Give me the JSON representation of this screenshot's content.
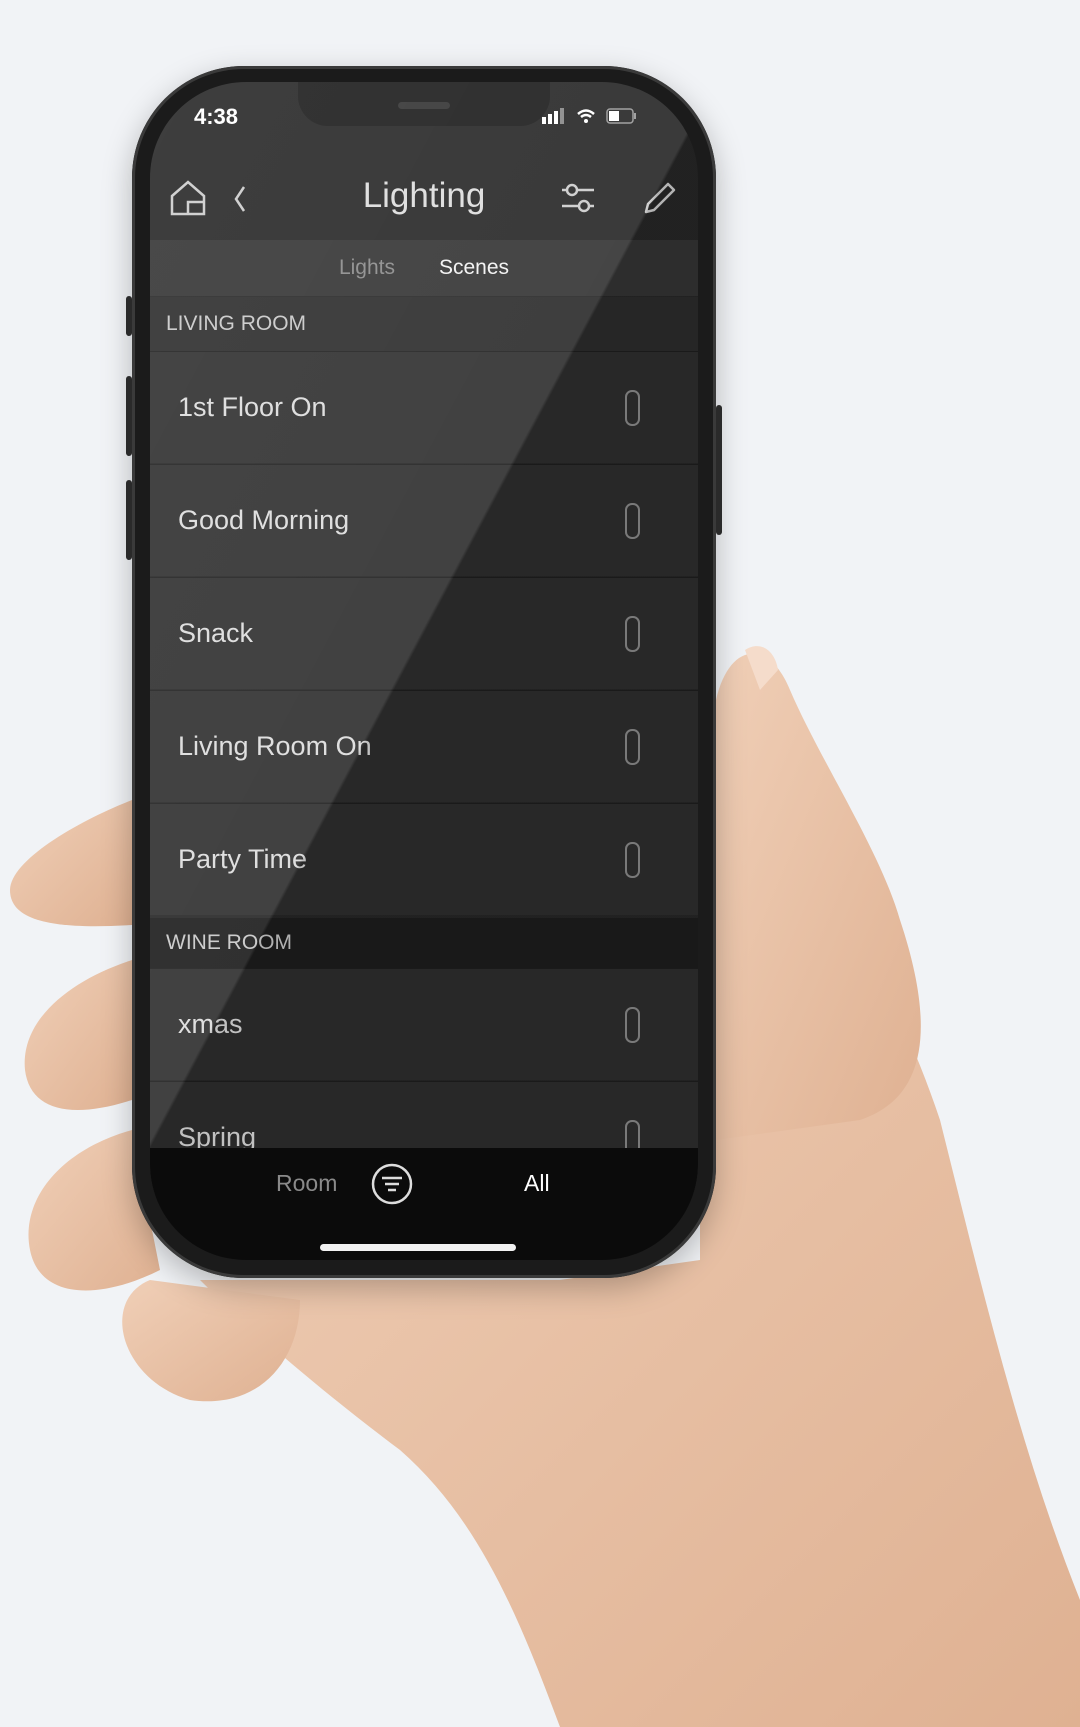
{
  "status_bar": {
    "time": "4:38",
    "icons": [
      "signal-icon",
      "wifi-icon",
      "battery-icon"
    ]
  },
  "header": {
    "title": "Lighting",
    "icons": [
      "home-icon",
      "back-chevron-icon",
      "sliders-icon",
      "pencil-icon"
    ]
  },
  "tabs": [
    {
      "label": "Lights",
      "active": false
    },
    {
      "label": "Scenes",
      "active": true
    }
  ],
  "sections": [
    {
      "title": "LIVING ROOM",
      "scenes": [
        "1st Floor On",
        "Good Morning",
        "Snack",
        "Living Room On",
        "Party Time"
      ]
    },
    {
      "title": "WINE ROOM",
      "scenes": [
        "xmas",
        "Spring"
      ]
    }
  ],
  "bottom_bar": {
    "left_label": "Room",
    "right_label": "All",
    "center_icon": "filter-icon"
  },
  "colors": {
    "background": "#f1f3f6",
    "screen": "#262626",
    "text": "#dcdcdc",
    "skin": "#e9c4a9"
  }
}
